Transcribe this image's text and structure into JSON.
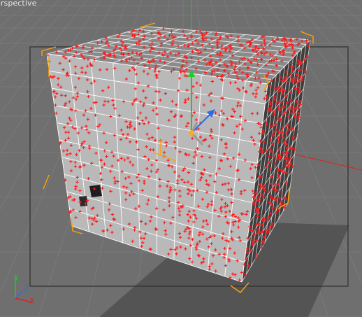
{
  "viewport": {
    "label": "erspective",
    "background_color": "#6f6f6f",
    "grid_color": "#7a7a7a",
    "safe_frame_color": "#2f2f2f",
    "shadow_color": "#545454"
  },
  "cube": {
    "front_color": "#b9b9b9",
    "top_color": "#8a8a8a",
    "side_color": "#3f3f3f",
    "wire_color": "#ffffff",
    "point_color": "#ff1a1a",
    "bounding_box_color": "#ffa200",
    "subdivisions": 10
  },
  "gizmo": {
    "y_color": "#15d21c",
    "x_color": "#e02020",
    "z_color": "#2f6be8",
    "handle_color": "#ffaa22",
    "icon": "move-handle-icon"
  },
  "axis_labels": {
    "x": "X",
    "y": "Y",
    "z": "Z"
  }
}
